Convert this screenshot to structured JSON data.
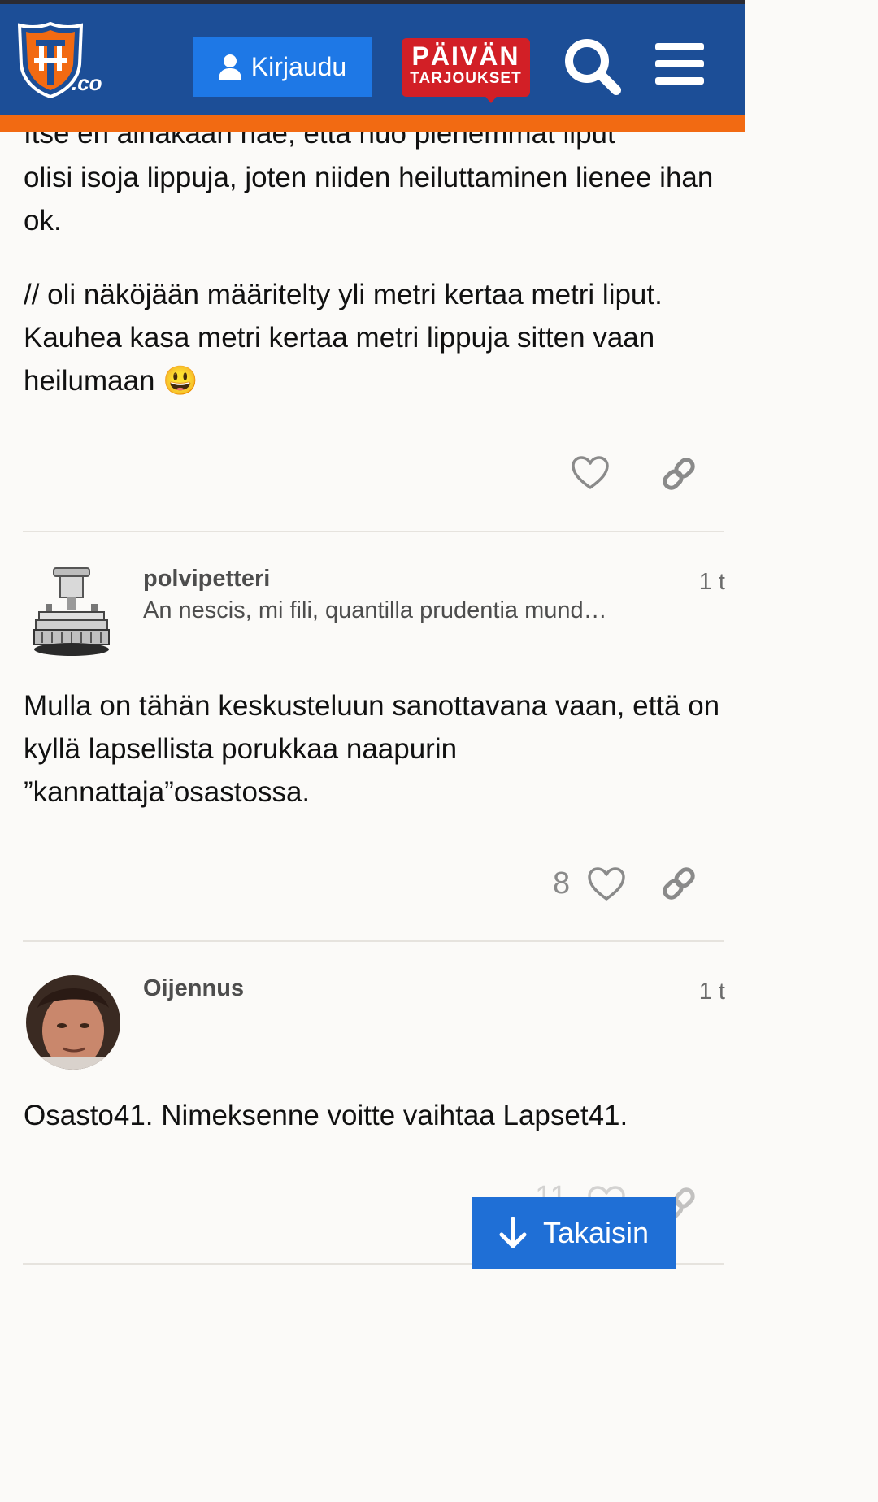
{
  "header": {
    "logo_text": ".co",
    "login_label": "Kirjaudu",
    "deals_line1": "PÄIVÄN",
    "deals_line2": "TARJOUKSET"
  },
  "post1": {
    "clipped_line": "Itse en ainakaan näe, että nuo pienemmät liput",
    "paragraph1": "olisi isoja lippuja, joten niiden heiluttaminen lienee ihan ok.",
    "paragraph2": "// oli näköjään määritelty yli metri kertaa metri liput. Kauhea kasa metri kertaa metri lippuja sitten vaan heilumaan",
    "emoji": "😃"
  },
  "post2": {
    "username": "polvipetteri",
    "user_title": "An nescis, mi fili, quantilla prudentia mund…",
    "age": "1 t",
    "body": "Mulla on tähän keskusteluun sanottavana vaan, että on kyllä lapsellista porukkaa naapurin ”kannattaja”osastossa.",
    "likes": "8"
  },
  "post3": {
    "username": "Oijennus",
    "age": "1 t",
    "body": "Osasto41. Nimeksenne voitte vaihtaa Lapset41.",
    "likes": "11"
  },
  "back_button": {
    "label": "Takaisin"
  },
  "icons": {
    "login": "user-icon",
    "search": "search-icon",
    "menu": "hamburger-menu-icon",
    "like": "heart-icon",
    "share": "link-icon",
    "back": "arrow-down-icon"
  },
  "colors": {
    "header_bg": "#1c4e97",
    "header_stripe": "#f26a12",
    "login_button": "#1e78e6",
    "deals_badge": "#d21f26",
    "back_button": "#1f6fd6"
  }
}
